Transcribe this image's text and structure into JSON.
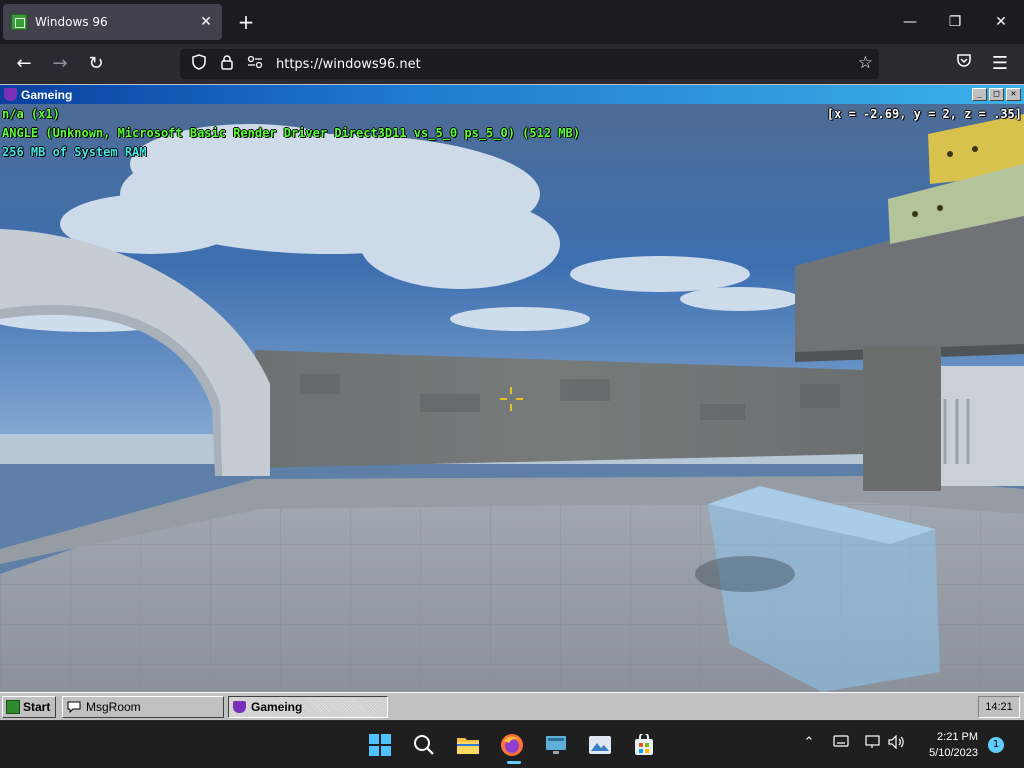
{
  "browser": {
    "tab_title": "Windows 96",
    "tab_close": "✕",
    "new_tab": "+",
    "url": "https://windows96.net",
    "window_controls": {
      "minimize": "—",
      "maximize": "❐",
      "close": "✕"
    },
    "nav": {
      "back": "←",
      "forward": "→",
      "reload": "↻",
      "menu": "☰"
    }
  },
  "window": {
    "title": "Gameing",
    "controls": {
      "minimize": "_",
      "maximize": "□",
      "close": "✕"
    }
  },
  "hud": {
    "line1": "n/a (x1)",
    "line2": "ANGLE (Unknown, Microsoft Basic Render Driver Direct3D11 vs_5_0 ps_5_0) (512 MB)",
    "line3": "256 MB of System RAM",
    "coords": "[x = -2.69, y = 2, z = .35]"
  },
  "w96_taskbar": {
    "start_label": "Start",
    "tasks": [
      {
        "label": "MsgRoom",
        "active": false
      },
      {
        "label": "Gameing",
        "active": true
      }
    ],
    "clock": "14:21"
  },
  "host_taskbar": {
    "time": "2:21 PM",
    "date": "5/10/2023",
    "notification_count": "1"
  },
  "colors": {
    "hud_green": "#5bff3a",
    "hud_cyan": "#46e8e6",
    "titlebar_start": "#0a3fa0",
    "titlebar_end": "#3cb0e8",
    "accent": "#60cdff"
  }
}
